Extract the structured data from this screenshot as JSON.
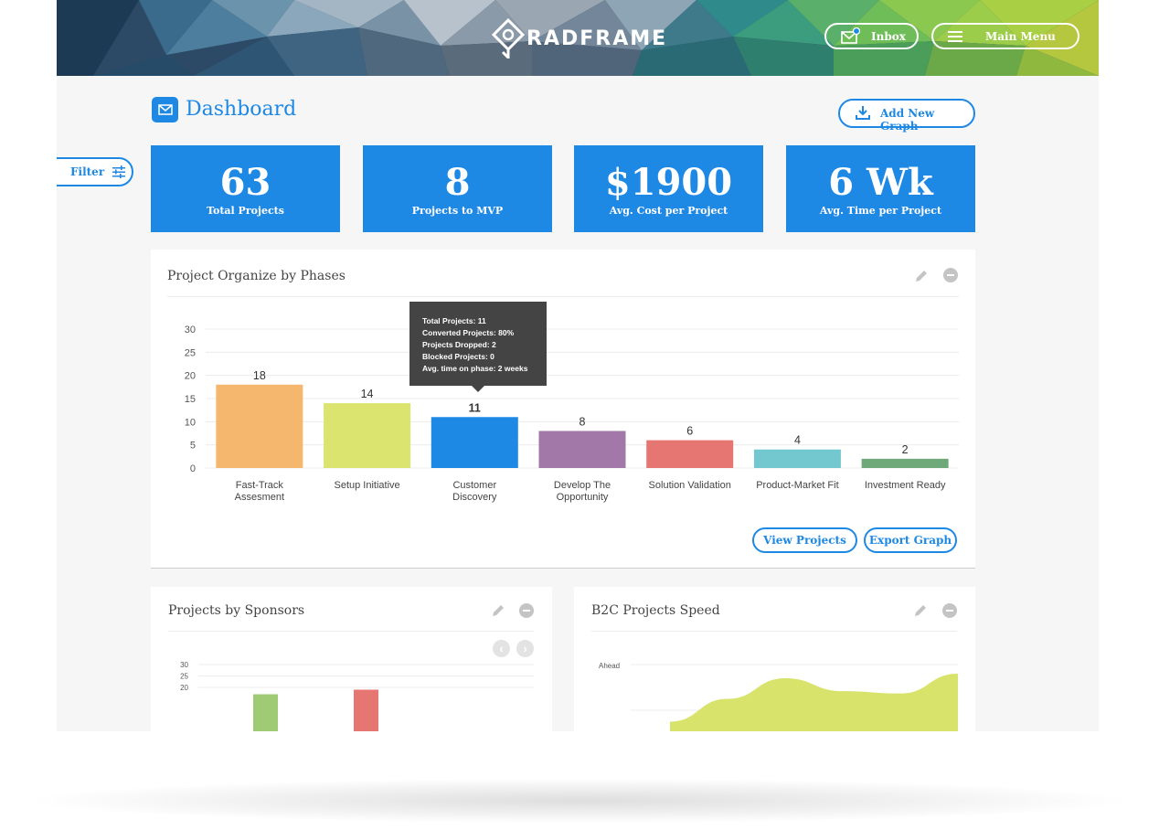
{
  "header": {
    "brand": "RADFRAME",
    "inbox_label": "Inbox",
    "menu_label": "Main Menu"
  },
  "page": {
    "title": "Dashboard",
    "add_graph_label": "Add New Graph",
    "filter_label": "Filter"
  },
  "stats": [
    {
      "value": "63",
      "label": "Total Projects"
    },
    {
      "value": "8",
      "label": "Projects to MVP"
    },
    {
      "value": "$1900",
      "label": "Avg. Cost per Project"
    },
    {
      "value": "6 Wk",
      "label": "Avg. Time per Project"
    }
  ],
  "main_panel": {
    "title": "Project Organize by Phases",
    "tooltip": [
      "Total Projects: 11",
      "Converted Projects: 80%",
      "Projects Dropped: 2",
      "Blocked Projects: 0",
      "Avg. time on phase: 2 weeks"
    ],
    "view_label": "View Projects",
    "export_label": "Export Graph"
  },
  "sponsors_panel": {
    "title": "Projects by Sponsors",
    "prev_icon": "‹",
    "next_icon": "›"
  },
  "speed_panel": {
    "title": "B2C Projects Speed"
  },
  "colors": {
    "accent": "#1e88e5",
    "header_text": "#ffffff"
  },
  "icons": [
    "inbox-icon",
    "menu-icon",
    "dashboard-icon",
    "download-icon",
    "sliders-icon",
    "pencil-icon",
    "minus-circle-icon",
    "chevron-left-icon",
    "chevron-right-icon"
  ],
  "chart_data": [
    {
      "type": "bar",
      "categories": [
        "Fast-Track\nAssesment",
        "Setup Initiative",
        "Customer\nDiscovery",
        "Develop The\nOpportunity",
        "Solution Validation",
        "Product-Market Fit",
        "Investment Ready"
      ],
      "values": [
        18,
        14,
        11,
        8,
        6,
        4,
        2
      ],
      "colors": [
        "#f5b76e",
        "#dbe46f",
        "#1e88e5",
        "#a278a8",
        "#e67671",
        "#73c8cf",
        "#6fa97a"
      ],
      "ylim": [
        0,
        30
      ],
      "yticks": [
        0,
        5,
        10,
        15,
        20,
        25,
        30
      ],
      "highlighted": 2,
      "grid": true
    },
    {
      "type": "bar",
      "categories": [
        "",
        ""
      ],
      "values": [
        17,
        19
      ],
      "colors": [
        "#9fcb74",
        "#e67671"
      ],
      "ylim": [
        0,
        30
      ],
      "yticks": [
        20,
        25,
        30
      ],
      "grid": true
    },
    {
      "type": "area",
      "x": [
        0,
        1,
        2,
        3,
        4,
        5
      ],
      "values": [
        0.15,
        0.45,
        0.72,
        0.55,
        0.52,
        0.78
      ],
      "color": "#d7e36a",
      "y_tick_labels": [
        "Ahead"
      ],
      "grid": true
    }
  ]
}
